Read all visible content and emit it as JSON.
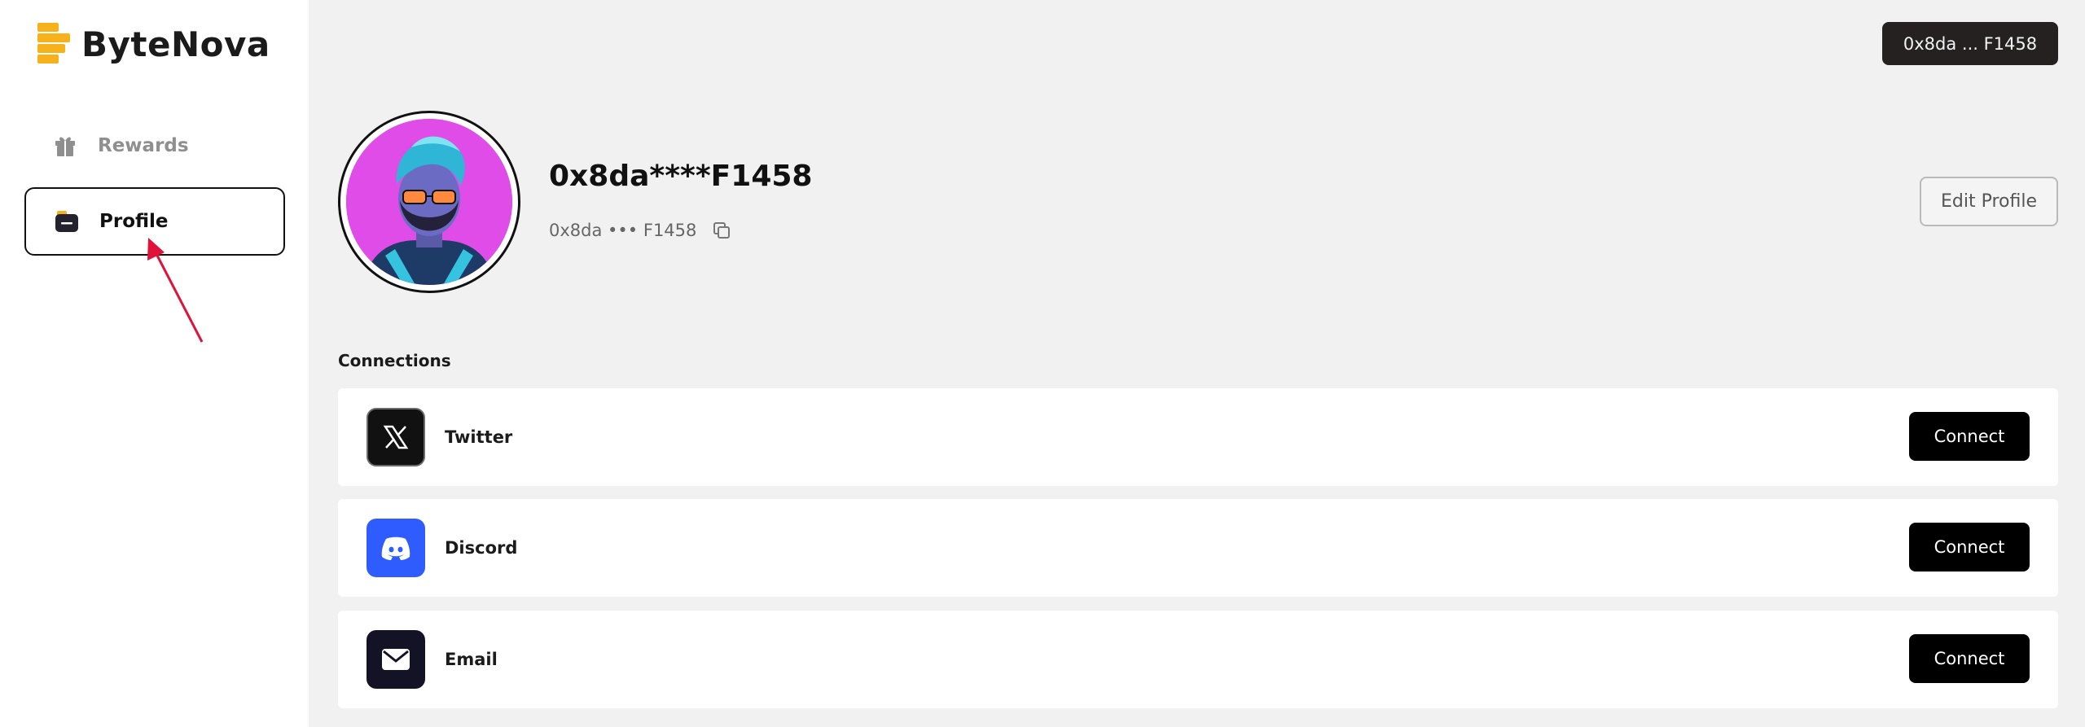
{
  "brand": {
    "name": "ByteNova",
    "accent": "#f7b21b"
  },
  "sidebar": {
    "items": [
      {
        "label": "Rewards",
        "icon": "gift-icon"
      },
      {
        "label": "Profile",
        "icon": "wallet-icon"
      }
    ]
  },
  "header": {
    "wallet_label": "0x8da ... F1458"
  },
  "profile": {
    "display_name": "0x8da****F1458",
    "short_address": "0x8da ••• F1458",
    "edit_label": "Edit Profile"
  },
  "connections": {
    "title": "Connections",
    "items": [
      {
        "label": "Twitter",
        "icon": "x-icon",
        "button": "Connect"
      },
      {
        "label": "Discord",
        "icon": "discord-icon",
        "button": "Connect"
      },
      {
        "label": "Email",
        "icon": "mail-icon",
        "button": "Connect"
      }
    ]
  }
}
